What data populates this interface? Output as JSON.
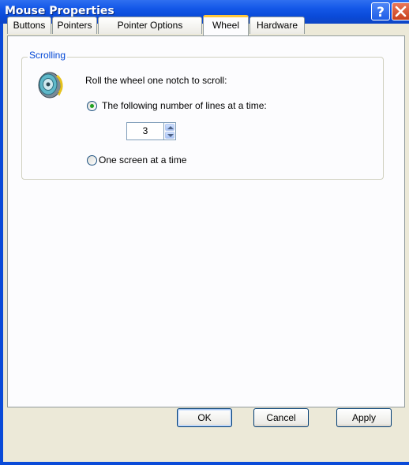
{
  "window": {
    "title": "Mouse Properties"
  },
  "titlebar": {
    "help_icon": "help-question-icon",
    "close_icon": "close-x-icon"
  },
  "tabs": [
    {
      "label": "Buttons",
      "active": false
    },
    {
      "label": "Pointers",
      "active": false
    },
    {
      "label": "Pointer Options",
      "active": false
    },
    {
      "label": "Wheel",
      "active": true
    },
    {
      "label": "Hardware",
      "active": false
    }
  ],
  "scrolling": {
    "group_label": "Scrolling",
    "icon": "mouse-wheel-icon",
    "instruction": "Roll the wheel one notch to scroll:",
    "option_lines_label": "The following number of lines at a time:",
    "lines_value": "3",
    "option_screen_label": "One screen at a time",
    "selected": "lines"
  },
  "buttons": {
    "ok": "OK",
    "cancel": "Cancel",
    "apply": "Apply"
  },
  "colors": {
    "titlebar": "#0a4ad8",
    "dialog_bg": "#ece9d8",
    "panel_bg": "#fcfcfe",
    "group_label": "#0046d5",
    "active_tab_accent": "#ffc73c",
    "radio_dot": "#21a121"
  }
}
